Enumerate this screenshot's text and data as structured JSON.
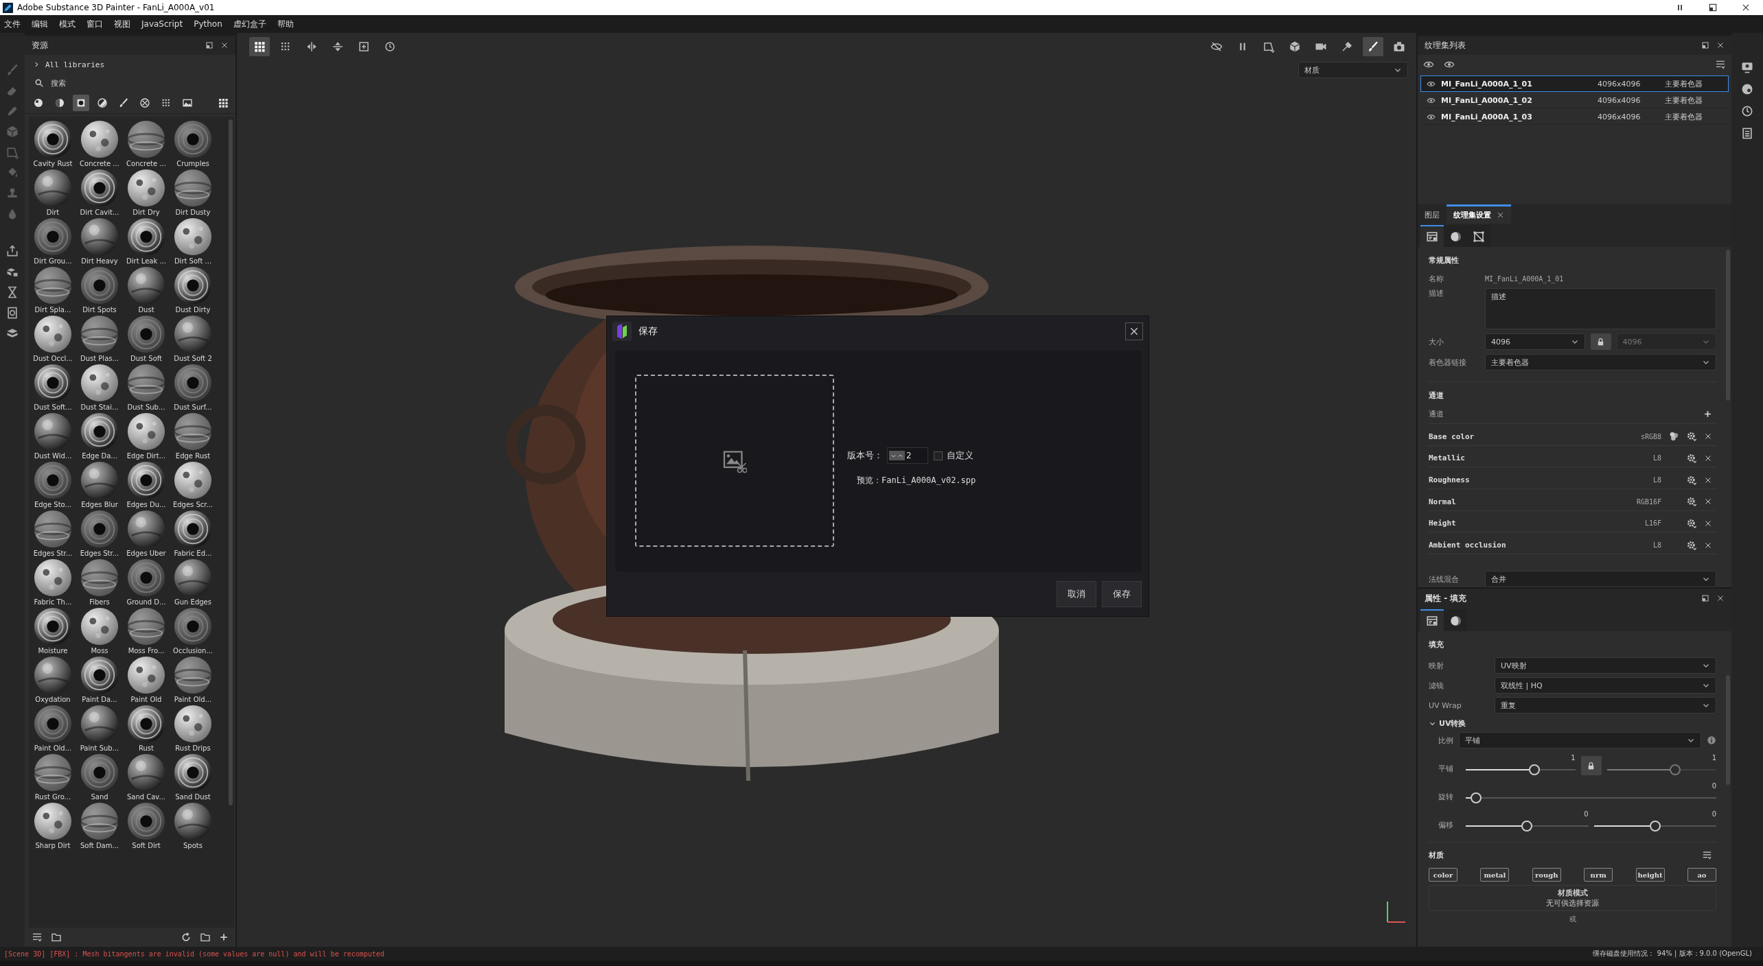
{
  "window": {
    "title": "Adobe Substance 3D Painter - FanLi_A000A_v01"
  },
  "menu": [
    "文件",
    "编辑",
    "模式",
    "窗口",
    "视图",
    "JavaScript",
    "Python",
    "虚幻盒子",
    "帮助"
  ],
  "assets": {
    "title": "资源",
    "library": "All libraries",
    "search": {
      "placeholder": "搜索"
    },
    "filters": [
      {
        "kind": "sphere",
        "selected": false
      },
      {
        "kind": "half",
        "selected": false
      },
      {
        "kind": "square",
        "selected": true
      },
      {
        "kind": "contrast",
        "selected": false
      },
      {
        "kind": "brush",
        "selected": false
      },
      {
        "kind": "checker",
        "selected": false
      },
      {
        "kind": "dots",
        "selected": false
      },
      {
        "kind": "landscape",
        "selected": false
      },
      {
        "kind": "grid",
        "selected": false
      }
    ],
    "items": [
      {
        "name": "Cavity Rust"
      },
      {
        "name": "Concrete ..."
      },
      {
        "name": "Concrete ..."
      },
      {
        "name": "Crumples"
      },
      {
        "name": "Dirt"
      },
      {
        "name": "Dirt Cavit..."
      },
      {
        "name": "Dirt Dry"
      },
      {
        "name": "Dirt Dusty"
      },
      {
        "name": "Dirt Grou..."
      },
      {
        "name": "Dirt Heavy"
      },
      {
        "name": "Dirt Leak ..."
      },
      {
        "name": "Dirt Soft ..."
      },
      {
        "name": "Dirt Spla..."
      },
      {
        "name": "Dirt Spots"
      },
      {
        "name": "Dust"
      },
      {
        "name": "Dust Dirty"
      },
      {
        "name": "Dust Occl..."
      },
      {
        "name": "Dust Plas..."
      },
      {
        "name": "Dust Soft"
      },
      {
        "name": "Dust Soft 2"
      },
      {
        "name": "Dust Soft..."
      },
      {
        "name": "Dust Stai..."
      },
      {
        "name": "Dust Sub..."
      },
      {
        "name": "Dust Surf..."
      },
      {
        "name": "Dust Wid..."
      },
      {
        "name": "Edge Da..."
      },
      {
        "name": "Edge Dirt..."
      },
      {
        "name": "Edge Rust"
      },
      {
        "name": "Edge Sto..."
      },
      {
        "name": "Edges Blur"
      },
      {
        "name": "Edges Du..."
      },
      {
        "name": "Edges Scr..."
      },
      {
        "name": "Edges Str..."
      },
      {
        "name": "Edges Str..."
      },
      {
        "name": "Edges Uber"
      },
      {
        "name": "Fabric Ed..."
      },
      {
        "name": "Fabric Th..."
      },
      {
        "name": "Fibers"
      },
      {
        "name": "Ground D..."
      },
      {
        "name": "Gun Edges"
      },
      {
        "name": "Moisture"
      },
      {
        "name": "Moss"
      },
      {
        "name": "Moss Fro..."
      },
      {
        "name": "Occlusion..."
      },
      {
        "name": "Oxydation"
      },
      {
        "name": "Paint Da..."
      },
      {
        "name": "Paint Old"
      },
      {
        "name": "Paint Old..."
      },
      {
        "name": "Paint Old..."
      },
      {
        "name": "Paint Sub..."
      },
      {
        "name": "Rust"
      },
      {
        "name": "Rust Drips"
      },
      {
        "name": "Rust Gro..."
      },
      {
        "name": "Sand"
      },
      {
        "name": "Sand Cav..."
      },
      {
        "name": "Sand Dust"
      },
      {
        "name": "Sharp Dirt"
      },
      {
        "name": "Soft Dam..."
      },
      {
        "name": "Soft Dirt"
      },
      {
        "name": "Spots"
      }
    ]
  },
  "viewport": {
    "toolbar_left": [
      {
        "kind": "grid",
        "selected": true
      },
      {
        "kind": "dots",
        "selected": false
      },
      {
        "kind": "mirror",
        "selected": false
      },
      {
        "kind": "flip",
        "selected": false
      },
      {
        "kind": "frame",
        "selected": false
      },
      {
        "kind": "history",
        "selected": false
      }
    ],
    "toolbar_right": [
      {
        "kind": "hide",
        "selected": false
      },
      {
        "kind": "pause",
        "selected": false
      },
      {
        "kind": "select",
        "selected": false
      },
      {
        "kind": "cube",
        "selected": false
      },
      {
        "kind": "video",
        "selected": false
      },
      {
        "kind": "tools",
        "selected": false
      },
      {
        "kind": "brush",
        "selected": true
      },
      {
        "kind": "camera",
        "selected": false
      }
    ],
    "channel_dropdown": "材质"
  },
  "dialog": {
    "title": "保存",
    "version_label": "版本号：",
    "version": "2",
    "custom": {
      "label": "自定义",
      "checked": false
    },
    "preview": "预览：FanLi_A000A_v02.spp",
    "buttons": [
      "取消",
      "保存"
    ]
  },
  "texture_sets": {
    "title": "纹理集列表",
    "rows": [
      {
        "name": "MI_FanLi_A000A_1_01",
        "resolution": "4096x4096",
        "shader": "主要着色器",
        "selected": true
      },
      {
        "name": "MI_FanLi_A000A_1_02",
        "resolution": "4096x4096",
        "shader": "主要着色器",
        "selected": false
      },
      {
        "name": "MI_FanLi_A000A_1_03",
        "resolution": "4096x4096",
        "shader": "主要着色器",
        "selected": false
      }
    ]
  },
  "settings": {
    "tabs": [
      {
        "label": "图层",
        "selected": false,
        "closable": false
      },
      {
        "label": "纹理集设置",
        "selected": true,
        "closable": true
      }
    ],
    "icon_tabs": [
      {
        "kind": "settings",
        "selected": true
      },
      {
        "kind": "shader",
        "selected": false
      },
      {
        "kind": "uv",
        "selected": false
      }
    ],
    "general_title": "常规属性",
    "name": {
      "label": "名称",
      "value": "MI_FanLi_A000A_1_01"
    },
    "description": {
      "label": "描述",
      "value": "描述"
    },
    "size": {
      "label": "大小",
      "value": "4096",
      "linked_value": "4096",
      "locked": true
    },
    "shader_link": {
      "label": "着色器链接",
      "value": "主要着色器"
    },
    "channels_title": "通道",
    "channels_add": "通道",
    "channels": [
      {
        "name": "Base color",
        "format": "sRGB8",
        "kind": "color"
      },
      {
        "name": "Metallic",
        "format": "L8",
        "kind": "data"
      },
      {
        "name": "Roughness",
        "format": "L8",
        "kind": "data"
      },
      {
        "name": "Normal",
        "format": "RGB16F",
        "kind": "data"
      },
      {
        "name": "Height",
        "format": "L16F",
        "kind": "data"
      },
      {
        "name": "Ambient occlusion",
        "format": "L8",
        "kind": "data"
      }
    ],
    "normal_mix": {
      "label": "法线混合",
      "value": "合并"
    }
  },
  "properties": {
    "title": "属性 - 填充",
    "icon_tabs": [
      {
        "kind": "settings",
        "selected": true
      },
      {
        "kind": "shader",
        "selected": false
      }
    ],
    "fill_title": "填充",
    "fields": [
      {
        "label": "映射",
        "value": "UV映射"
      },
      {
        "label": "滤镜",
        "value": "双线性 | HQ"
      },
      {
        "label": "UV Wrap",
        "value": "重复"
      }
    ],
    "uv_transform": {
      "title": "UV转换",
      "expanded": true,
      "scale": {
        "label": "比例",
        "value": "平铺"
      },
      "rows": [
        {
          "label": "平铺",
          "linked": true,
          "sliders": [
            {
              "reading": "1",
              "level": 0.64,
              "disabled": false
            },
            {
              "reading": "1",
              "level": 0.64,
              "disabled": true
            }
          ]
        },
        {
          "label": "旋转",
          "linked": false,
          "sliders": [
            {
              "reading": "0",
              "level": 0.02,
              "disabled": false
            }
          ]
        },
        {
          "label": "偏移",
          "linked": false,
          "sliders": [
            {
              "reading": "0",
              "level": 0.5,
              "disabled": false
            },
            {
              "reading": "0",
              "level": 0.5,
              "disabled": false
            }
          ]
        }
      ]
    },
    "material_title": "材质",
    "material_channels": [
      "color",
      "metal",
      "rough",
      "nrm",
      "height",
      "ao"
    ],
    "mode_title": "材质模式",
    "mode_text": "无可供选择资源",
    "or": "或"
  },
  "status": {
    "message": "[Scene 3D] [FBX] : Mesh bitangents are invalid (some values are null) and will be recomputed",
    "info": "缓存磁盘使用情况： 94% | 版本：9.0.0 (OpenGL)"
  }
}
